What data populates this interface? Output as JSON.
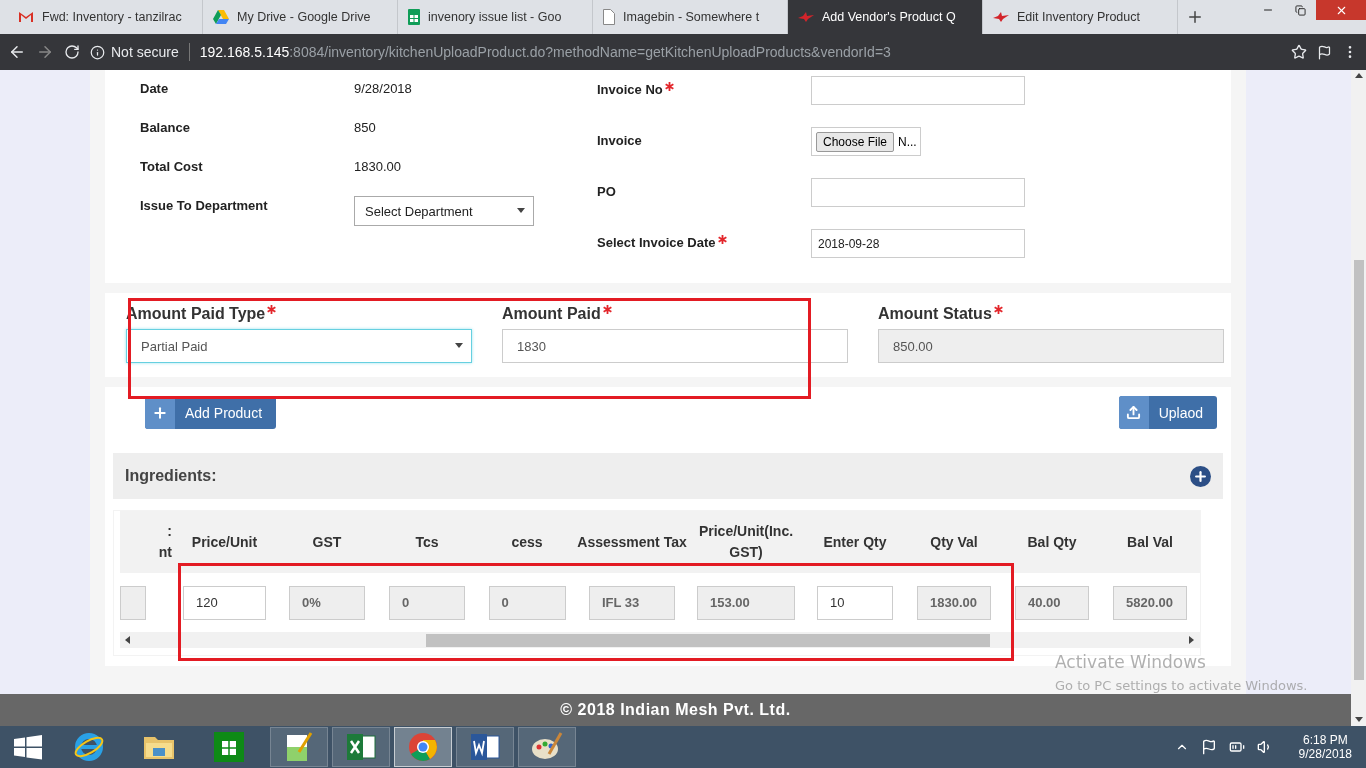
{
  "browser": {
    "tabs": [
      {
        "title": "Fwd: Inventory - tanzilrac",
        "kind": "mail",
        "selected": false
      },
      {
        "title": "My Drive - Google Drive",
        "kind": "drive",
        "selected": false
      },
      {
        "title": "invenory issue list - Goo",
        "kind": "sheet",
        "selected": false
      },
      {
        "title": "Imagebin - Somewhere t",
        "kind": "doc",
        "selected": false
      },
      {
        "title": "Add Vendor's Product Q",
        "kind": "vendor",
        "selected": true
      },
      {
        "title": "Edit Inventory Product",
        "kind": "vendor",
        "selected": false
      }
    ],
    "security": "Not secure",
    "url_host": "192.168.5.145",
    "url_rest": ":8084/inventory/kitchenUploadProduct.do?methodName=getKitchenUploadProducts&vendorId=3"
  },
  "details": {
    "left": [
      {
        "label": "Date",
        "value": "9/28/2018",
        "kind": "text"
      },
      {
        "label": "Balance",
        "value": "850",
        "kind": "text"
      },
      {
        "label": "Total Cost",
        "value": "1830.00",
        "kind": "text"
      },
      {
        "label": "Issue To Department",
        "value": "Select Department",
        "kind": "select"
      }
    ],
    "right": [
      {
        "label": "Invoice No",
        "required": true,
        "kind": "input"
      },
      {
        "label": "Invoice",
        "required": false,
        "kind": "file",
        "button": "Choose File",
        "value": "N..."
      },
      {
        "label": "PO",
        "required": false,
        "kind": "input"
      },
      {
        "label": "Select Invoice Date",
        "required": true,
        "kind": "input",
        "value": "2018-09-28"
      }
    ]
  },
  "payment": [
    {
      "label": "Amount Paid Type",
      "required": true,
      "kind": "select",
      "value": "Partial Paid",
      "focused": true
    },
    {
      "label": "Amount Paid",
      "required": true,
      "kind": "input",
      "value": "1830",
      "focused": false
    },
    {
      "label": "Amount Status",
      "required": true,
      "kind": "readonly",
      "value": "850.00",
      "focused": false
    }
  ],
  "actions": {
    "add": "Add Product",
    "upload": "Uplaod"
  },
  "ingredients": {
    "title": "Ingredients:",
    "columns": [
      {
        "label": ":\nnt",
        "editable": false
      },
      {
        "label": "Price/Unit",
        "value": "120",
        "editable": true
      },
      {
        "label": "GST",
        "value": "0%",
        "editable": false
      },
      {
        "label": "Tcs",
        "value": "0",
        "editable": false
      },
      {
        "label": "cess",
        "value": "0",
        "editable": false
      },
      {
        "label": "Assessment Tax",
        "value": "IFL 33",
        "editable": false
      },
      {
        "label": "Price/Unit(Inc. GST)",
        "value": "153.00",
        "editable": false
      },
      {
        "label": "Enter Qty",
        "value": "10",
        "editable": true
      },
      {
        "label": "Qty Val",
        "value": "1830.00",
        "editable": false
      },
      {
        "label": "Bal Qty",
        "value": "40.00",
        "editable": false
      },
      {
        "label": "Bal Val",
        "value": "5820.00",
        "editable": false
      }
    ]
  },
  "footer": "© 2018 Indian Mesh Pvt. Ltd.",
  "activation": {
    "title": "Activate Windows",
    "message": "Go to PC settings to activate Windows."
  },
  "taskbar": {
    "apps": [
      {
        "kind": "ie",
        "running": false,
        "selected": false
      },
      {
        "kind": "folder",
        "running": false,
        "selected": false
      },
      {
        "kind": "store",
        "running": false,
        "selected": false
      },
      {
        "kind": "notepad",
        "running": true,
        "selected": false
      },
      {
        "kind": "excel",
        "running": true,
        "selected": false
      },
      {
        "kind": "chrome",
        "running": true,
        "selected": true
      },
      {
        "kind": "word",
        "running": true,
        "selected": false
      },
      {
        "kind": "paint",
        "running": true,
        "selected": false
      }
    ],
    "time": "6:18 PM",
    "date": "9/28/2018"
  }
}
